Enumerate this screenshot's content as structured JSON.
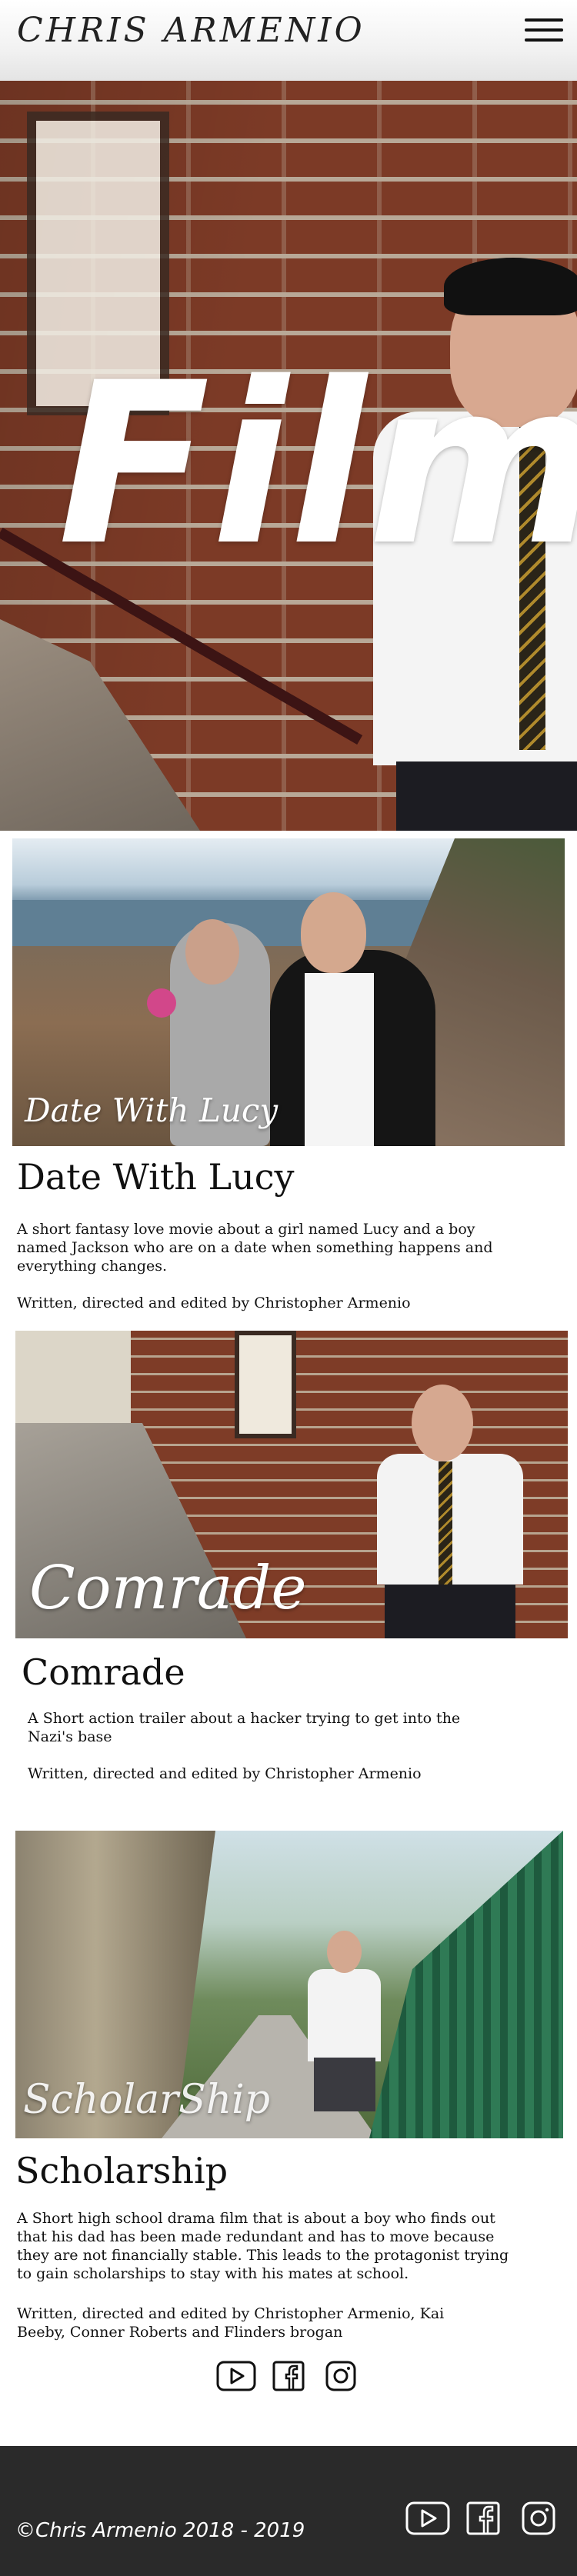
{
  "header": {
    "title": "CHRIS ARMENIO",
    "menu_icon": "hamburger-menu-icon"
  },
  "hero": {
    "title": "Film"
  },
  "films": [
    {
      "thumb_label": "Date With Lucy",
      "title": "Date With Lucy",
      "description": "A short fantasy love movie about a girl named Lucy and a boy named Jackson who are on a date when something happens and everything changes.",
      "credits": "Written, directed and edited by Christopher Armenio"
    },
    {
      "thumb_label": "Comrade",
      "title": "Comrade",
      "description": "A Short action trailer about a hacker trying to get into the Nazi's base",
      "credits": "Written, directed and edited by Christopher Armenio"
    },
    {
      "thumb_label": "ScholarShip",
      "title": "Scholarship",
      "description": "A Short high school drama film that is about a boy who finds out that his dad has been made redundant and has to move because they are not financially stable. This leads to the protagonist trying to gain scholarships to stay with his mates at school.",
      "credits": "Written, directed and edited by Christopher Armenio, Kai Beeby, Conner Roberts and Flinders brogan"
    }
  ],
  "social_icons": [
    "youtube-icon",
    "facebook-icon",
    "instagram-icon"
  ],
  "footer": {
    "copyright": "©Chris Armenio 2018 - 2019"
  }
}
